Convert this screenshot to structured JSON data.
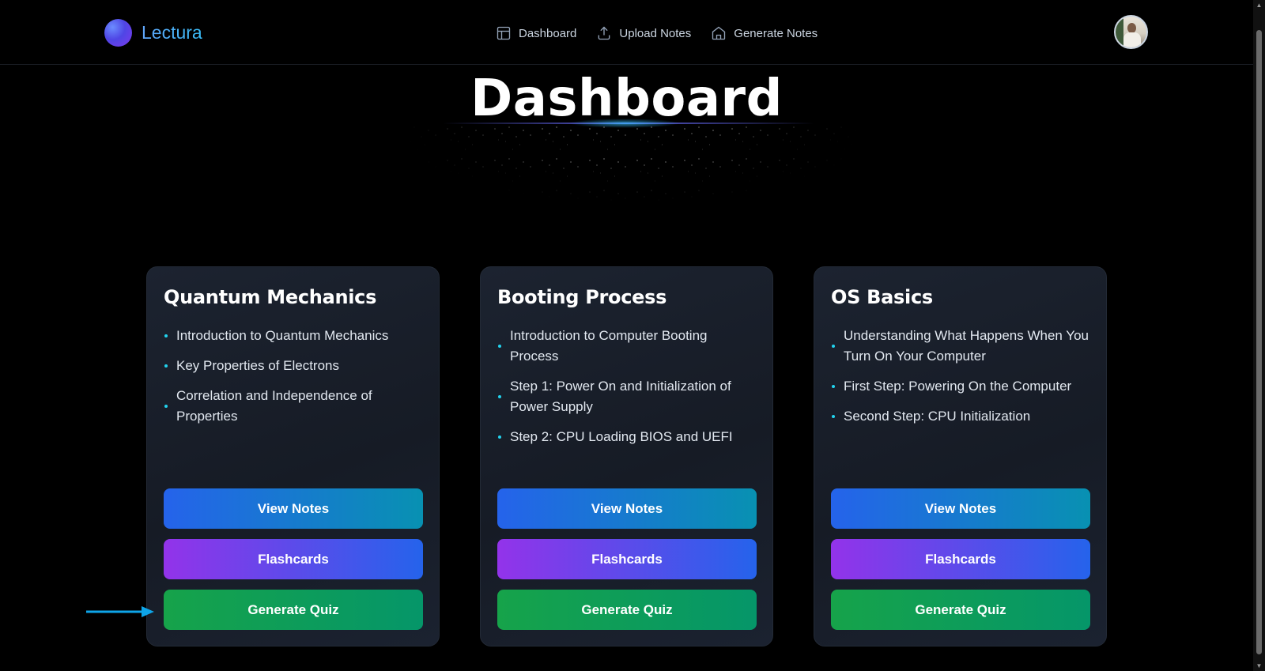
{
  "app": {
    "name": "Lectura"
  },
  "nav": {
    "items": [
      {
        "label": "Dashboard",
        "icon": "layout-icon"
      },
      {
        "label": "Upload Notes",
        "icon": "upload-icon"
      },
      {
        "label": "Generate Notes",
        "icon": "home-icon"
      }
    ]
  },
  "page": {
    "title": "Dashboard"
  },
  "cards": [
    {
      "title": "Quantum Mechanics",
      "topics": [
        "Introduction to Quantum Mechanics",
        "Key Properties of Electrons",
        "Correlation and Independence of Properties"
      ],
      "buttons": {
        "notes": "View Notes",
        "flashcards": "Flashcards",
        "quiz": "Generate Quiz"
      }
    },
    {
      "title": "Booting Process",
      "topics": [
        "Introduction to Computer Booting Process",
        "Step 1: Power On and Initialization of Power Supply",
        "Step 2: CPU Loading BIOS and UEFI"
      ],
      "buttons": {
        "notes": "View Notes",
        "flashcards": "Flashcards",
        "quiz": "Generate Quiz"
      }
    },
    {
      "title": "OS Basics",
      "topics": [
        "Understanding What Happens When You Turn On Your Computer",
        "First Step: Powering On the Computer",
        "Second Step: CPU Initialization"
      ],
      "buttons": {
        "notes": "View Notes",
        "flashcards": "Flashcards",
        "quiz": "Generate Quiz"
      }
    }
  ],
  "colors": {
    "background": "#000000",
    "card": "#1a202b",
    "accent_blue": "#2563eb",
    "accent_cyan": "#22d3ee",
    "accent_purple": "#9333ea",
    "accent_green": "#16a34a",
    "annotation_arrow": "#0ea5e9"
  }
}
